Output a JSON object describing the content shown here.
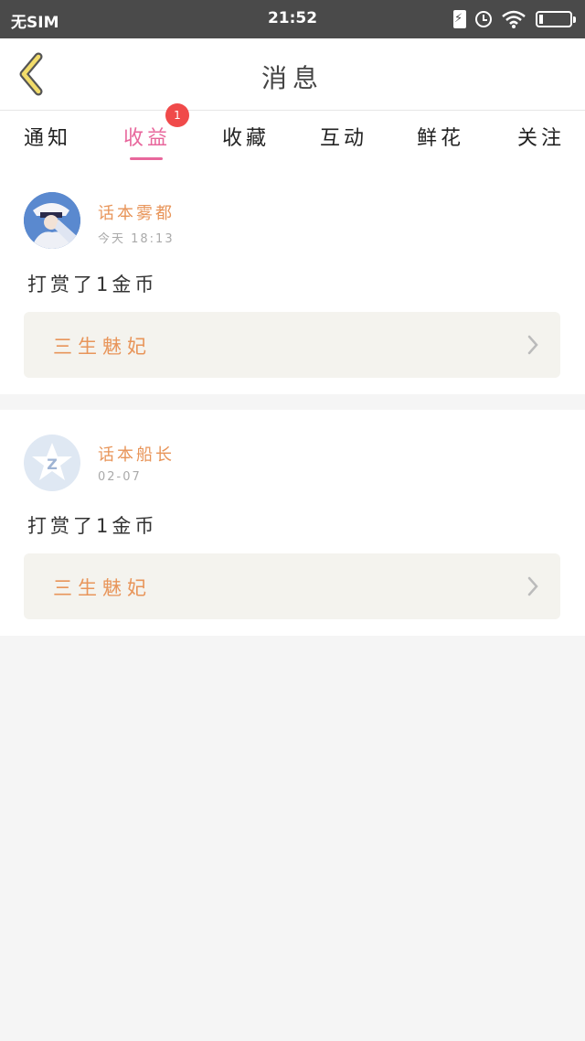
{
  "status_bar": {
    "carrier": "无SIM",
    "time": "21:52"
  },
  "nav": {
    "title": "消息",
    "back_icon": "chevron-left-icon"
  },
  "tabs": [
    {
      "label": "通知",
      "active": false
    },
    {
      "label": "收益",
      "active": true,
      "badge": "1"
    },
    {
      "label": "收藏",
      "active": false
    },
    {
      "label": "互动",
      "active": false
    },
    {
      "label": "鲜花",
      "active": false
    },
    {
      "label": "关注",
      "active": false
    }
  ],
  "messages": [
    {
      "user": "话本雾都",
      "time": "今天 18:13",
      "content": "打赏了1金币",
      "book": "三生魅妃"
    },
    {
      "user": "话本船长",
      "time": "02-07",
      "content": "打赏了1金币",
      "book": "三生魅妃"
    }
  ],
  "colors": {
    "accent": "#e8679c",
    "name": "#e8955a",
    "badge": "#f04a4a",
    "status_bar": "#4a4a4a"
  }
}
